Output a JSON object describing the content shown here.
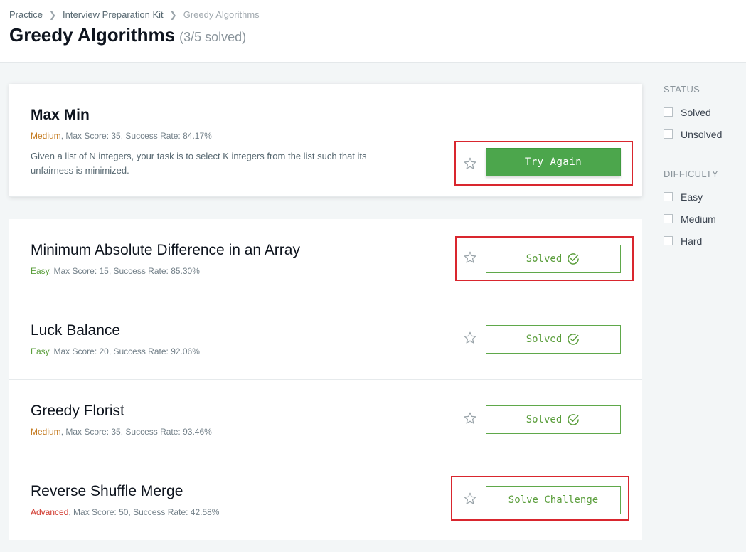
{
  "breadcrumb": [
    "Practice",
    "Interview Preparation Kit",
    "Greedy Algorithms"
  ],
  "page": {
    "title": "Greedy Algorithms",
    "progress": "(3/5 solved)"
  },
  "challenges": [
    {
      "name": "Max Min",
      "difficulty": "Medium",
      "stats": ", Max Score: 35, Success Rate: 84.17%",
      "description": "Given a list of N integers, your task is to select K integers from the list such that its unfairness is minimized.",
      "action": "Try Again"
    },
    {
      "name": "Minimum Absolute Difference in an Array",
      "difficulty": "Easy",
      "stats": ", Max Score: 15, Success Rate: 85.30%",
      "action": "Solved"
    },
    {
      "name": "Luck Balance",
      "difficulty": "Easy",
      "stats": ", Max Score: 20, Success Rate: 92.06%",
      "action": "Solved"
    },
    {
      "name": "Greedy Florist",
      "difficulty": "Medium",
      "stats": ", Max Score: 35, Success Rate: 93.46%",
      "action": "Solved"
    },
    {
      "name": "Reverse Shuffle Merge",
      "difficulty": "Advanced",
      "stats": ", Max Score: 50, Success Rate: 42.58%",
      "action": "Solve Challenge"
    }
  ],
  "filters": {
    "status_heading": "STATUS",
    "status_options": [
      "Solved",
      "Unsolved"
    ],
    "difficulty_heading": "DIFFICULTY",
    "difficulty_options": [
      "Easy",
      "Medium",
      "Hard"
    ]
  },
  "colors": {
    "accent_green": "#4ca64c",
    "easy": "#5a9e3b",
    "medium": "#c57c22",
    "advanced": "#d0352a",
    "highlight_box": "#d9262e"
  }
}
